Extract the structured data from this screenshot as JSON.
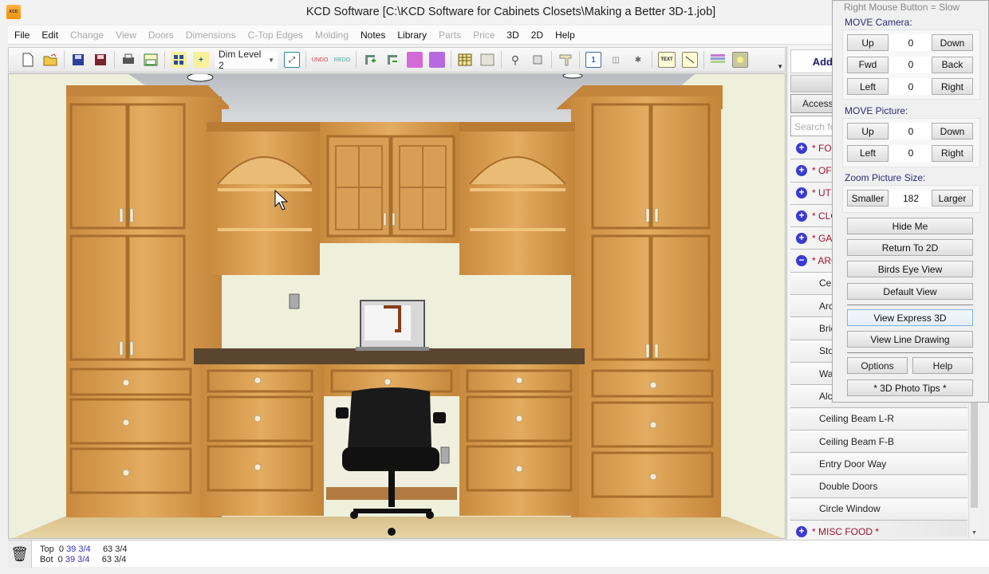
{
  "window": {
    "title": "KCD Software [C:\\KCD Software for Cabinets Closets\\Making a Better 3D-1.job]",
    "app_icon": "KCD"
  },
  "menu": [
    {
      "label": "File",
      "enabled": true
    },
    {
      "label": "Edit",
      "enabled": true
    },
    {
      "label": "Change",
      "enabled": false
    },
    {
      "label": "View",
      "enabled": false
    },
    {
      "label": "Doors",
      "enabled": false
    },
    {
      "label": "Dimensions",
      "enabled": false
    },
    {
      "label": "C-Top Edges",
      "enabled": false
    },
    {
      "label": "Molding",
      "enabled": false
    },
    {
      "label": "Notes",
      "enabled": true
    },
    {
      "label": "Library",
      "enabled": true
    },
    {
      "label": "Parts",
      "enabled": false
    },
    {
      "label": "Price",
      "enabled": false
    },
    {
      "label": "3D",
      "enabled": true
    },
    {
      "label": "2D",
      "enabled": true
    },
    {
      "label": "Help",
      "enabled": true
    }
  ],
  "toolbar": {
    "dim_level": "Dim Level 2",
    "icons": [
      "new-file-icon",
      "open-folder-icon",
      "save-icon",
      "save-as-icon",
      "print-icon",
      "layout-icon",
      "grid-icon",
      "add-dims-icon",
      "dim-level-select",
      "zoom-fit-icon",
      "undo-icon",
      "redo-icon",
      "add-row-icon",
      "remove-row-icon",
      "cabinet-icon",
      "cabinet-alt-icon",
      "table-icon",
      "list-icon",
      "zoom-in-icon",
      "frame-icon",
      "molding-icon",
      "page-icon",
      "columns-icon",
      "wand-icon",
      "text-icon",
      "line-icon",
      "layers-icon",
      "render-icon"
    ],
    "undo_label": "UNDO",
    "redo_label": "REDO",
    "text_label": "TEXT"
  },
  "left_pane": {
    "add_label": "Add",
    "access_label": "Accessories",
    "search_placeholder": "Search for"
  },
  "library": {
    "rows": [
      {
        "type": "cat",
        "label": "* FOOD *",
        "expanded": false
      },
      {
        "type": "cat",
        "label": "* OFFICE *",
        "expanded": false
      },
      {
        "type": "cat",
        "label": "* UTILITY *",
        "expanded": false
      },
      {
        "type": "cat",
        "label": "* CLOSET *",
        "expanded": false
      },
      {
        "type": "cat",
        "label": "* GARAGE *",
        "expanded": false
      },
      {
        "type": "cat",
        "label": "* ARCHITECTURAL *",
        "expanded": true
      },
      {
        "type": "item",
        "label": "Ceiling"
      },
      {
        "type": "item",
        "label": "Arch"
      },
      {
        "type": "item",
        "label": "Bricks"
      },
      {
        "type": "item",
        "label": "Stone"
      },
      {
        "type": "item",
        "label": "Wall"
      },
      {
        "type": "item",
        "label": "Alcove"
      },
      {
        "type": "item",
        "label": "Ceiling Beam L-R"
      },
      {
        "type": "item",
        "label": "Ceiling Beam F-B"
      },
      {
        "type": "item",
        "label": "Entry Door Way"
      },
      {
        "type": "item",
        "label": "Double Doors"
      },
      {
        "type": "item",
        "label": "Circle Window"
      },
      {
        "type": "cat",
        "label": "* MISC FOOD *",
        "expanded": false
      }
    ]
  },
  "panel": {
    "hint": "Right Mouse Button = Slow",
    "camera_label": "MOVE Camera:",
    "camera": [
      {
        "left": "Up",
        "value": "0",
        "right": "Down"
      },
      {
        "left": "Fwd",
        "value": "0",
        "right": "Back"
      },
      {
        "left": "Left",
        "value": "0",
        "right": "Right"
      }
    ],
    "picture_label": "MOVE Picture:",
    "picture": [
      {
        "left": "Up",
        "value": "0",
        "right": "Down"
      },
      {
        "left": "Left",
        "value": "0",
        "right": "Right"
      }
    ],
    "zoom_label": "Zoom Picture Size:",
    "zoom": {
      "left": "Smaller",
      "value": "182",
      "right": "Larger"
    },
    "buttons": {
      "hide_me": "Hide Me",
      "return_2d": "Return To 2D",
      "birds_eye": "Birds Eye View",
      "default_view": "Default View",
      "express_3d": "View Express 3D",
      "line_drawing": "View Line Drawing",
      "options": "Options",
      "help": "Help",
      "photo_tips": "* 3D Photo Tips *"
    }
  },
  "status": {
    "top": {
      "label": "Top",
      "a": "0",
      "b": "39 3/4",
      "c": "63 3/4"
    },
    "bot": {
      "label": "Bot",
      "a": "0",
      "b": "39 3/4",
      "c": "63 3/4"
    }
  },
  "colors": {
    "category_text": "#a0122e",
    "group_label": "#2b2b7a",
    "wood": "#d59a4e"
  }
}
